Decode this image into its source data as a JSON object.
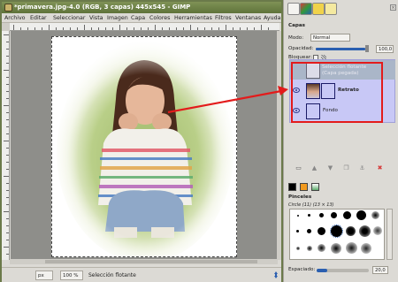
{
  "window": {
    "title": "*primavera.jpg-4.0 (RGB, 3 capas) 445x545 - GIMP"
  },
  "menu": [
    "Archivo",
    "Editar",
    "Seleccionar",
    "Vista",
    "Imagen",
    "Capa",
    "Colores",
    "Herramientas",
    "Filtros",
    "Ventanas",
    "Ayuda"
  ],
  "statusbar": {
    "unit": "px",
    "zoom": "100 %",
    "message": "Selección flotante"
  },
  "colors": {
    "titlebar": "#6b7d45",
    "layer_selection": "#c8c8f6",
    "highlight": "#e31b1b",
    "arrow": "#e31b1b"
  },
  "layers_dialog": {
    "title": "Capas",
    "mode_label": "Modo:",
    "mode_value": "Normal",
    "opacity_label": "Opacidad:",
    "opacity_value": "100,0",
    "lock_label": "Bloquear:",
    "layers": [
      {
        "name": "Selección flotante (Capa pegada)",
        "name_line1": "Selección flotante",
        "name_line2": "(Capa pegada)",
        "visible": false
      },
      {
        "name": "Retrato",
        "visible": true
      },
      {
        "name": "Fondo",
        "visible": true
      }
    ],
    "layer_buttons": [
      "new-layer-icon",
      "raise-layer-icon",
      "lower-layer-icon",
      "duplicate-layer-icon",
      "anchor-layer-icon",
      "delete-layer-icon"
    ]
  },
  "brushes_dialog": {
    "title": "Pinceles",
    "current_brush": "Circle (11) (13 × 13)",
    "spacing_label": "Espaciado:",
    "spacing_value": "20,0"
  }
}
